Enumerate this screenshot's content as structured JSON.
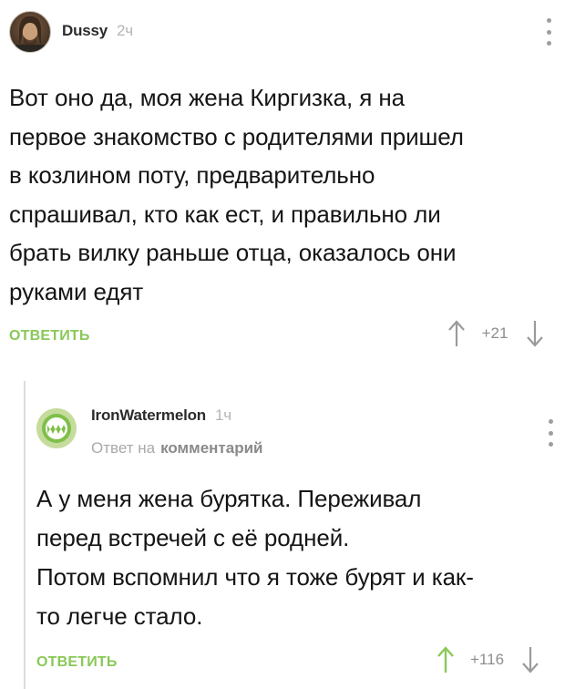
{
  "comments": [
    {
      "author": "Dussy",
      "time": "2ч",
      "avatar": "avatar-photo",
      "text": "Вот оно да, моя жена Киргизка, я на\nпервое знакомство с родителями пришел\nв козлином поту, предварительно\nспрашивал, кто как ест, и правильно ли\nбрать вилку раньше отца, оказалось они\nруками едят",
      "reply_label": "ОТВЕТИТЬ",
      "score": "+21",
      "upvote_color": "#9a9a9a"
    },
    {
      "author": "IronWatermelon",
      "time": "1ч",
      "avatar": "watermelon-avatar",
      "reply_to_prefix": "Ответ на",
      "reply_to_link": "комментарий",
      "text": "А у меня жена бурятка. Переживал\nперед встречей с её родней.\nПотом вспомнил что я тоже бурят и как-\nто легче стало.",
      "reply_label": "ОТВЕТИТЬ",
      "score": "+116",
      "upvote_color": "#8ac858"
    }
  ],
  "colors": {
    "accent_green": "#8ac858",
    "muted": "#a9a9a9",
    "text": "#151515"
  }
}
